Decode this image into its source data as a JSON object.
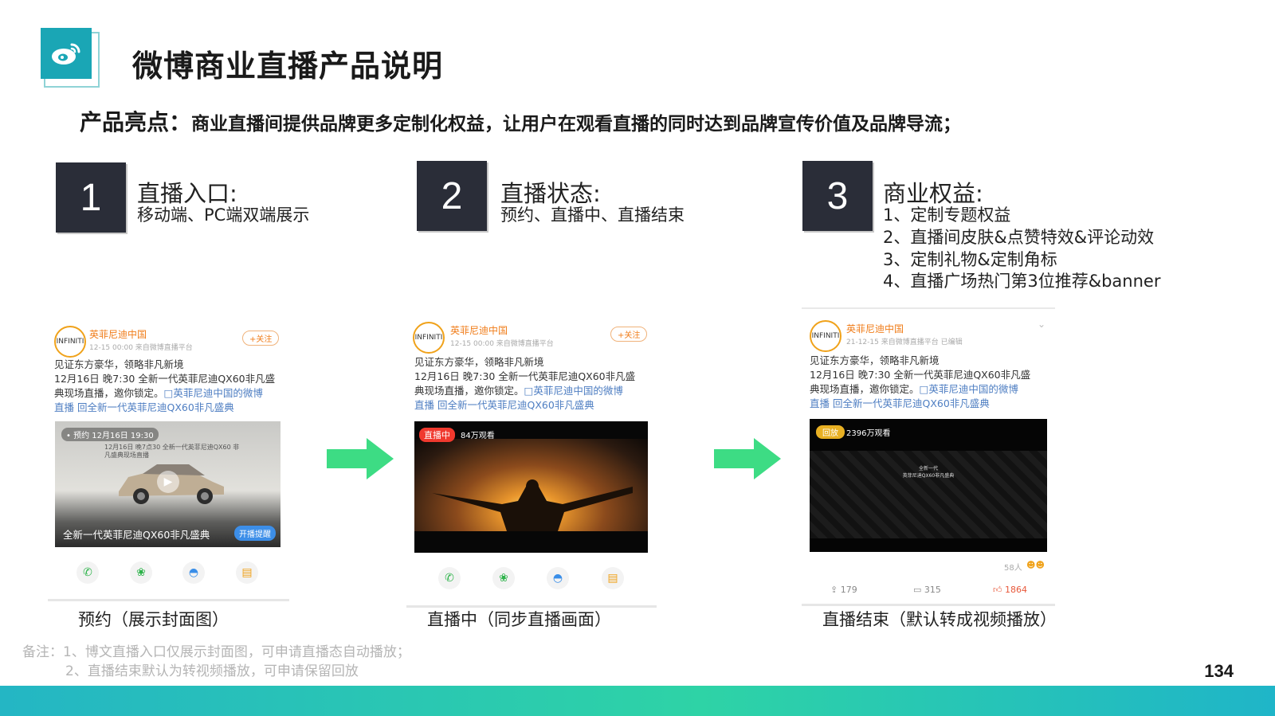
{
  "header": {
    "title": "微博商业直播产品说明",
    "logo_icon": "weibo-logo-icon"
  },
  "highlight": {
    "label": "产品亮点：",
    "text": "商业直播间提供品牌更多定制化权益，让用户在观看直播的同时达到品牌宣传价值及品牌导流；"
  },
  "steps": [
    {
      "num": "1",
      "title": "直播入口:",
      "lines": [
        "移动端、PC端双端展示"
      ]
    },
    {
      "num": "2",
      "title": "直播状态:",
      "lines": [
        "预约、直播中、直播结束"
      ]
    },
    {
      "num": "3",
      "title": "商业权益:",
      "lines": [
        "1、定制专题权益",
        "2、直播间皮肤&点赞特效&评论动效",
        "3、定制礼物&定制角标",
        "4、直播广场热门第3位推荐&banner"
      ]
    }
  ],
  "cards": [
    {
      "brand": "英菲尼迪中国",
      "avatar": "INFINITI",
      "meta": "12-15 00:00  来自微博直播平台",
      "follow": "+关注",
      "post_line1": "见证东方豪华，领略非凡新境",
      "post_line2": "12月16日 晚7:30 全新一代英菲尼迪QX60非凡盛",
      "post_line3a": "典现场直播，邀你锁定。",
      "post_line3b": "□英菲尼迪中国的微博",
      "post_line4": "直播 回全新一代英菲尼迪QX60非凡盛典",
      "badge": "• 预约 12月16日 19:30",
      "overlay": "12月16日 晚7点30 全新一代英菲尼迪QX60 非凡盛典现场直播",
      "bottom_text": "全新一代英菲尼迪QX60非凡盛典",
      "button": "开播提醒",
      "caption": "预约（展示封面图）"
    },
    {
      "brand": "英菲尼迪中国",
      "avatar": "INFINITI",
      "meta": "12-15 00:00  来自微博直播平台",
      "follow": "+关注",
      "post_line1": "见证东方豪华，领略非凡新境",
      "post_line2": "12月16日 晚7:30 全新一代英菲尼迪QX60非凡盛",
      "post_line3a": "典现场直播，邀你锁定。",
      "post_line3b": "□英菲尼迪中国的微博",
      "post_line4": "直播 回全新一代英菲尼迪QX60非凡盛典",
      "live_badge": "直播中",
      "viewers": "84万观看",
      "caption": "直播中（同步直播画面）"
    },
    {
      "brand": "英菲尼迪中国",
      "avatar": "INFINITI",
      "meta": "21-12-15  来自微博直播平台  已编辑",
      "post_line1": "见证东方豪华，领略非凡新境",
      "post_line2": "12月16日 晚7:30 全新一代英菲尼迪QX60非凡盛",
      "post_line3a": "典现场直播，邀你锁定。",
      "post_line3b": "□英菲尼迪中国的微博",
      "post_line4": "直播 回全新一代英菲尼迪QX60非凡盛典",
      "replay_badge": "回放",
      "viewers": "2396万观看",
      "video_text1": "全新一代",
      "video_text2": "英菲尼迪QX60非凡盛典",
      "likes_small": "58人",
      "repost": "179",
      "comment": "315",
      "like": "1864",
      "caption": "直播结束（默认转成视频播放）"
    }
  ],
  "notes": {
    "line1": "备注：1、博文直播入口仅展示封面图，可申请直播态自动播放；",
    "line2": "2、直播结束默认为转视频播放，可申请保留回放"
  },
  "page_number": "134",
  "colors": {
    "accent": "#1aa6b5",
    "arrow": "#3ddc84",
    "dark_box": "#2a2d38",
    "brand_orange": "#f07d1a",
    "link": "#4e7ec2"
  }
}
